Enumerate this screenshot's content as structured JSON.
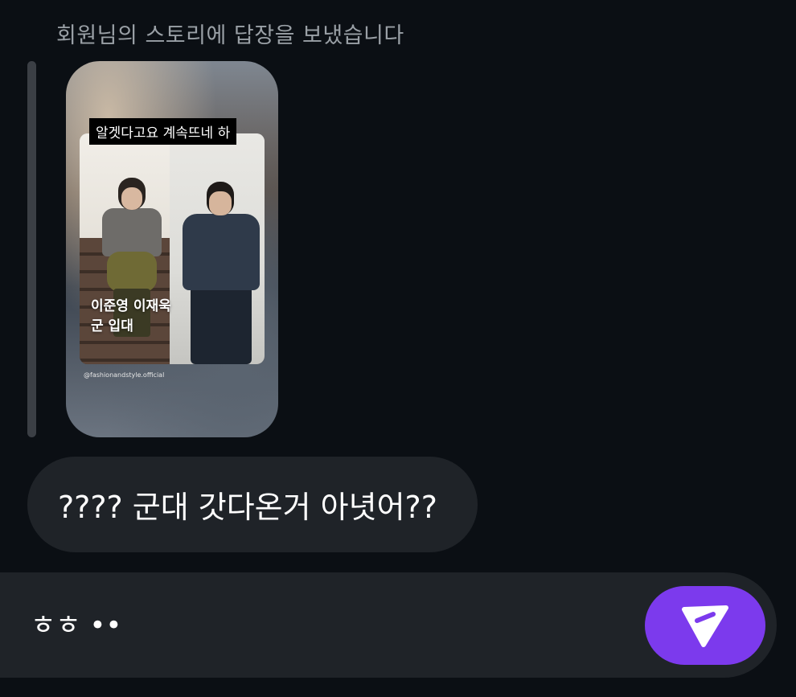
{
  "reply_caption": "회원님의 스토리에 답장을 보냈습니다",
  "story": {
    "top_label": "알겟다고요 계속뜨네 하",
    "headline_line1": "이준영 이재욱",
    "headline_line2": "군 입대",
    "handle": "@fashionandstyle.official"
  },
  "message": {
    "text": "???? 군대 갓다온거 아녓어??"
  },
  "composer": {
    "input_value": "ㅎㅎ ••",
    "send_icon": "send-icon"
  },
  "colors": {
    "background": "#0b0f14",
    "bubble": "#1f2328",
    "send_button": "#7c3aed",
    "caption": "#9aa0a6"
  }
}
